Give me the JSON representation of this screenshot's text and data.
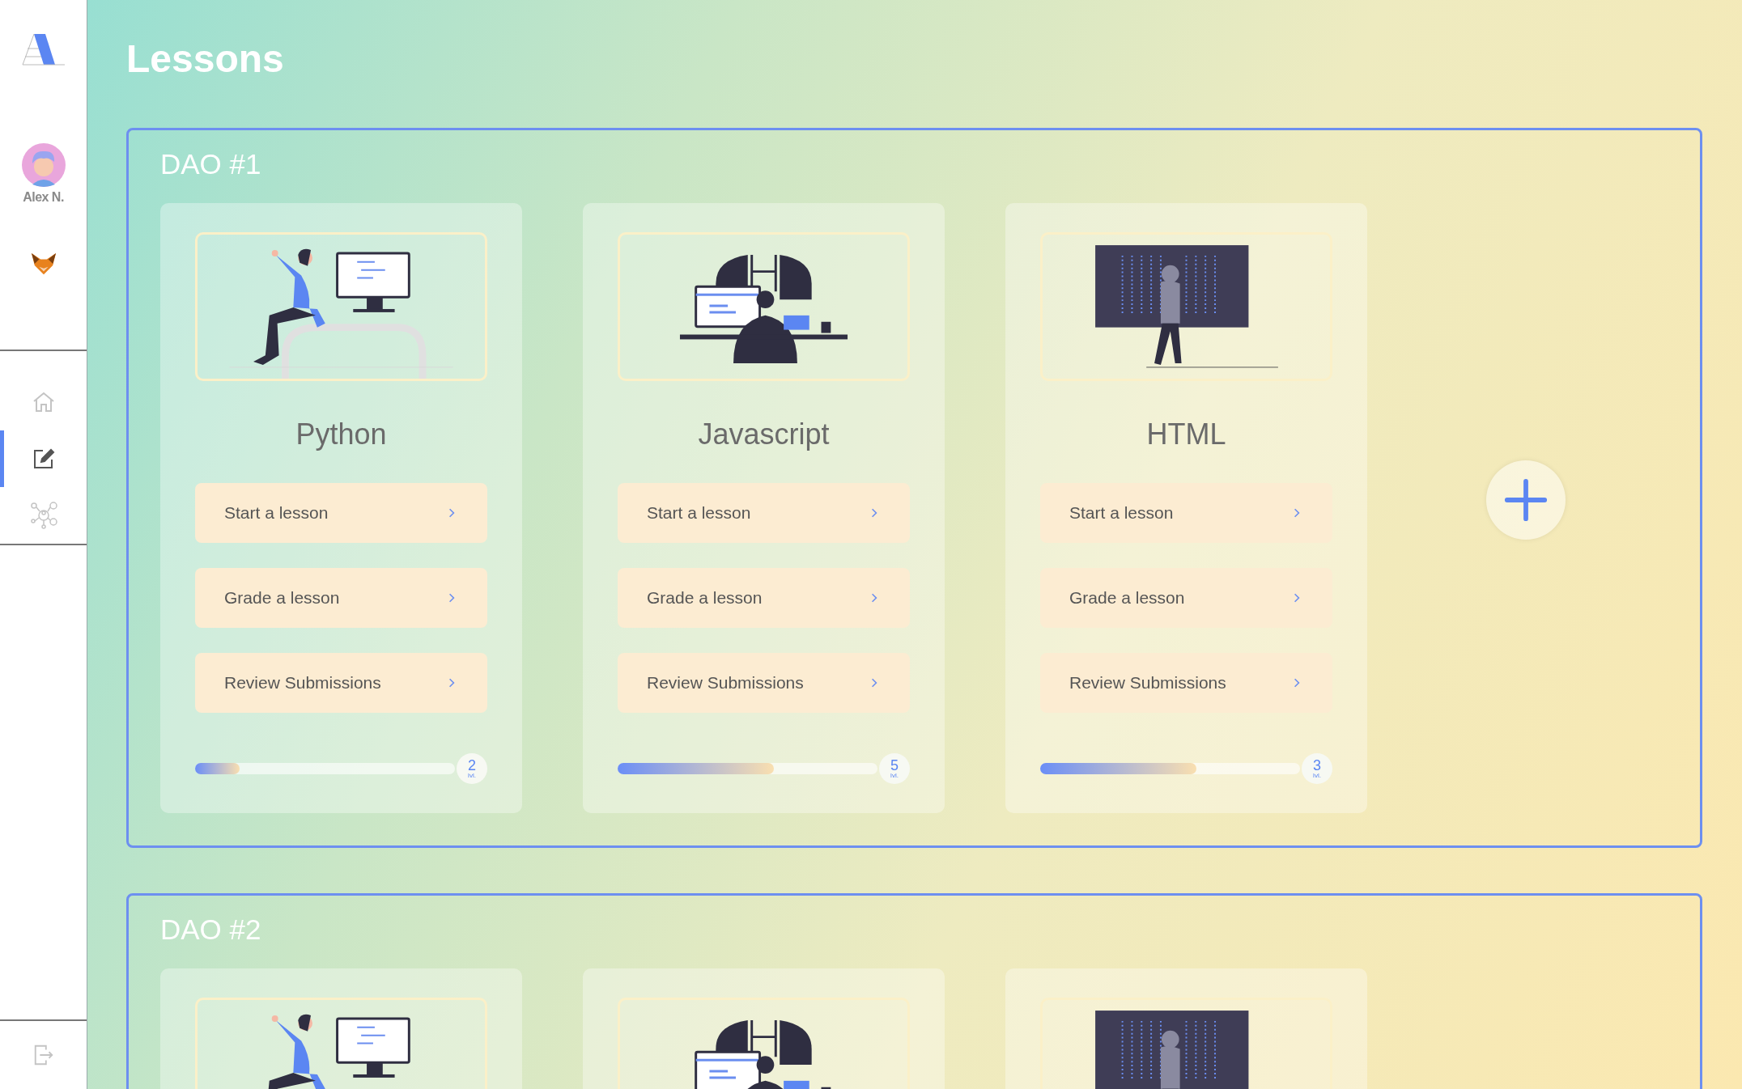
{
  "sidebar": {
    "user": {
      "name": "Alex N."
    },
    "nav": [
      {
        "kind": "home",
        "selected": false
      },
      {
        "kind": "edit",
        "selected": true
      },
      {
        "kind": "network",
        "selected": false
      }
    ]
  },
  "page_title": "Lessons",
  "daos": [
    {
      "name": "DAO #1",
      "add_button": true,
      "lessons": [
        {
          "kind": "woman-at-desk",
          "title": "Python",
          "actions": [
            "Start a lesson",
            "Grade a lesson",
            "Review Submissions"
          ],
          "level": 0.17,
          "level_number": "2",
          "level_unit": "lvl."
        },
        {
          "kind": "person-at-computer",
          "title": "Javascript",
          "actions": [
            "Start a lesson",
            "Grade a lesson",
            "Review Submissions"
          ],
          "level": 0.6,
          "level_number": "5",
          "level_unit": "lvl."
        },
        {
          "kind": "figure-at-screen",
          "title": "HTML",
          "actions": [
            "Start a lesson",
            "Grade a lesson",
            "Review Submissions"
          ],
          "level": 0.6,
          "level_number": "3",
          "level_unit": "lvl."
        }
      ]
    },
    {
      "name": "DAO #2",
      "lessons": [
        {
          "kind": "woman-at-desk"
        },
        {
          "kind": "person-at-computer"
        },
        {
          "kind": "figure-at-screen"
        }
      ]
    }
  ]
}
